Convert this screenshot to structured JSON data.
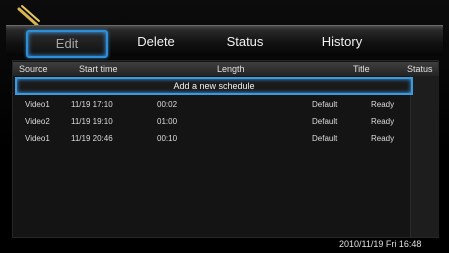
{
  "tabs": [
    "Edit",
    "Delete",
    "Status",
    "History"
  ],
  "table": {
    "columns": [
      "Source",
      "Start time",
      "Length",
      "Title",
      "Status"
    ],
    "add_row": "Add a new schedule",
    "rows": [
      {
        "source": "Video1",
        "start": "11/19 17:10",
        "length": "00:02",
        "title": "Default",
        "status": "Ready"
      },
      {
        "source": "Video2",
        "start": "11/19 19:10",
        "length": "01:00",
        "title": "Default",
        "status": "Ready"
      },
      {
        "source": "Video1",
        "start": "11/19 20:46",
        "length": "00:10",
        "title": "Default",
        "status": "Ready"
      }
    ]
  },
  "datetime": "2010/11/19 Fri 16:48"
}
